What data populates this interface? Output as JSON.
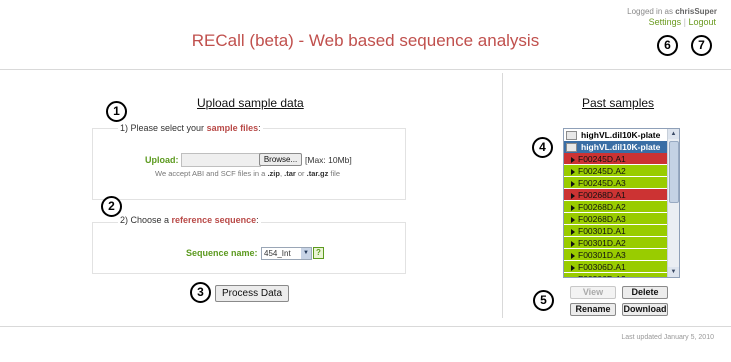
{
  "header": {
    "title": "RECall (beta) - Web based sequence analysis",
    "logged_in_prefix": "Logged in as",
    "username": "chrisSuper",
    "settings": "Settings",
    "logout": "Logout"
  },
  "markers": [
    "1",
    "2",
    "3",
    "4",
    "5",
    "6",
    "7"
  ],
  "upload": {
    "heading": "Upload sample data",
    "step1_prefix": "1) Please select your",
    "step1_highlight": "sample files",
    "step1_suffix": ":",
    "upload_label": "Upload:",
    "browse": "Browse...",
    "max_size": "[Max: 10Mb]",
    "hint_prefix": "We accept ABI and SCF files in a",
    "ext_zip": ".zip",
    "ext_tar": ".tar",
    "hint_or": "or",
    "ext_targz": ".tar.gz",
    "hint_suffix": "file",
    "step2_prefix": "2) Choose a",
    "step2_highlight": "reference sequence",
    "step2_suffix": ":",
    "sequence_label": "Sequence name:",
    "sequence_value": "454_Int",
    "help": "?",
    "process": "Process Data"
  },
  "past": {
    "heading": "Past samples",
    "groups": [
      {
        "label": "highVL.dil10K-plate",
        "selected": false
      },
      {
        "label": "highVL.dil10K-plate",
        "selected": true
      }
    ],
    "items": [
      {
        "label": "F00245D.A1",
        "status": "fail"
      },
      {
        "label": "F00245D.A2",
        "status": "pass"
      },
      {
        "label": "F00245D.A3",
        "status": "pass"
      },
      {
        "label": "F00268D.A1",
        "status": "fail"
      },
      {
        "label": "F00268D.A2",
        "status": "pass"
      },
      {
        "label": "F00268D.A3",
        "status": "pass"
      },
      {
        "label": "F00301D.A1",
        "status": "pass"
      },
      {
        "label": "F00301D.A2",
        "status": "pass"
      },
      {
        "label": "F00301D.A3",
        "status": "pass"
      },
      {
        "label": "F00306D.A1",
        "status": "pass"
      },
      {
        "label": "F00306D.A2",
        "status": "pass"
      }
    ],
    "view": "View",
    "delete": "Delete",
    "rename": "Rename",
    "download": "Download"
  },
  "footer": {
    "last_updated": "Last updated January 5, 2010"
  },
  "colors": {
    "title": "#c0504d",
    "accent_green": "#5c9a1f",
    "fail": "#cc3333",
    "pass": "#99cc00",
    "selected": "#3a6ea5"
  },
  "icons": {
    "folder": "folder-icon",
    "item": "triangle-right-icon",
    "dropdown": "chevron-down-icon"
  }
}
